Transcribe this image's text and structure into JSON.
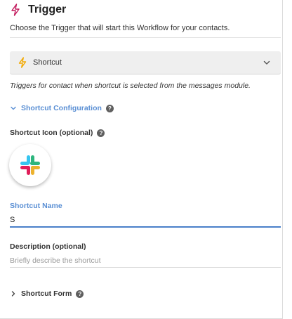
{
  "header": {
    "icon": "lightning-bolt-icon",
    "title": "Trigger",
    "subtitle": "Choose the Trigger that will start this Workflow for your contacts."
  },
  "trigger_select": {
    "icon": "lightning-bolt-icon",
    "selected": "Shortcut",
    "chevron_icon": "chevron-down-icon"
  },
  "trigger_note": "Triggers for contact when shortcut is selected from the messages module.",
  "configuration": {
    "label": "Shortcut Configuration",
    "expanded": true,
    "help_icon": "question-circle-icon"
  },
  "shortcut_icon": {
    "label": "Shortcut Icon (optional)",
    "help_icon": "question-circle-icon",
    "selected_icon": "slack-logo-icon"
  },
  "shortcut_name": {
    "label": "Shortcut Name",
    "value": "S"
  },
  "description": {
    "label": "Description (optional)",
    "placeholder": "Briefly describe the shortcut",
    "value": ""
  },
  "shortcut_form": {
    "label": "Shortcut Form",
    "expanded": false,
    "help_icon": "question-circle-icon"
  },
  "colors": {
    "accent": "#5a8fd4",
    "input_focus": "#4a7fc9",
    "bolt_header": "#c2185b",
    "bolt_select": "#f2a900",
    "slack_blue": "#36c5f0",
    "slack_green": "#2eb67d",
    "slack_yellow": "#ecb22e",
    "slack_red": "#e01e5a"
  }
}
